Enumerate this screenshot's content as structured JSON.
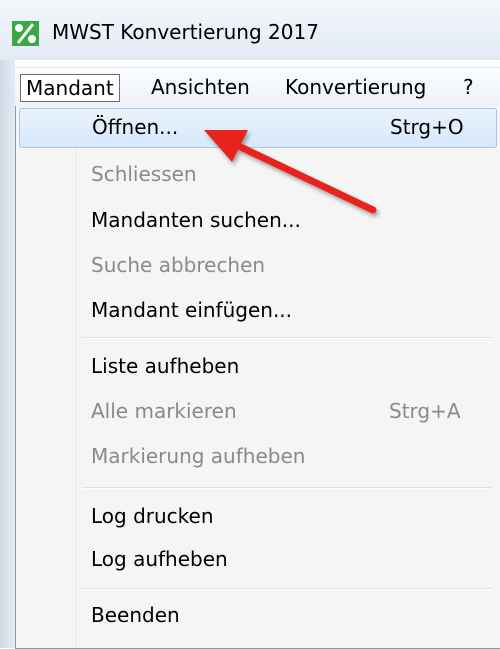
{
  "window": {
    "title": "MWST Konvertierung 2017"
  },
  "menubar": {
    "items": [
      {
        "label": "Mandant",
        "active": true
      },
      {
        "label": "Ansichten",
        "active": false
      },
      {
        "label": "Konvertierung",
        "active": false
      },
      {
        "label": "?",
        "active": false
      }
    ]
  },
  "dropdown": {
    "items": [
      {
        "label": "Öffnen...",
        "shortcut": "Strg+O",
        "enabled": true,
        "highlighted": true
      },
      {
        "label": "Schliessen",
        "shortcut": "",
        "enabled": false,
        "highlighted": false
      },
      {
        "label": "Mandanten suchen...",
        "shortcut": "",
        "enabled": true,
        "highlighted": false
      },
      {
        "label": "Suche abbrechen",
        "shortcut": "",
        "enabled": false,
        "highlighted": false
      },
      {
        "label": "Mandant einfügen...",
        "shortcut": "",
        "enabled": true,
        "highlighted": false
      },
      {
        "label": "Liste aufheben",
        "shortcut": "",
        "enabled": true,
        "highlighted": false
      },
      {
        "label": "Alle markieren",
        "shortcut": "Strg+A",
        "enabled": false,
        "highlighted": false
      },
      {
        "label": "Markierung aufheben",
        "shortcut": "",
        "enabled": false,
        "highlighted": false
      },
      {
        "label": "Log drucken",
        "shortcut": "",
        "enabled": true,
        "highlighted": false
      },
      {
        "label": "Log aufheben",
        "shortcut": "",
        "enabled": true,
        "highlighted": false
      },
      {
        "label": "Beenden",
        "shortcut": "",
        "enabled": true,
        "highlighted": false
      }
    ]
  },
  "colors": {
    "highlight": "#d7e8fb",
    "disabled_text": "#8a8a8a",
    "arrow": "#e8221b",
    "app_icon_bg": "#3aa844"
  }
}
